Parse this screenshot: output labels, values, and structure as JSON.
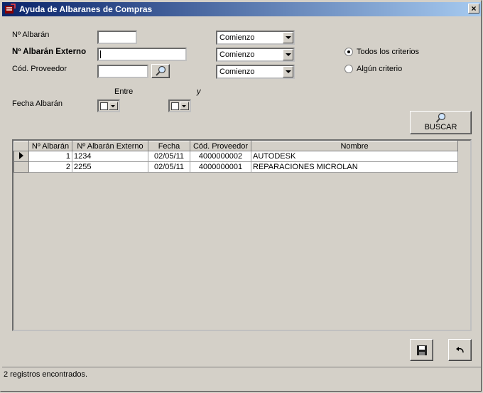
{
  "window": {
    "title": "Ayuda de Albaranes de Compras",
    "close": "×"
  },
  "form": {
    "albaran_label": "Nº Albarán",
    "externo_label": "Nº Albarán Externo",
    "proveedor_label": "Cód. Proveedor",
    "entre_label": "Entre",
    "y_label": "y",
    "fecha_label": "Fecha Albarán",
    "combo_albaran": "Comienzo",
    "combo_externo": "Comienzo",
    "combo_proveedor": "Comienzo",
    "radio_todos": "Todos los criterios",
    "radio_alguno": "Algún criterio",
    "buscar": "BUSCAR"
  },
  "table": {
    "headers": [
      "Nº Albarán",
      "Nº Albarán Externo",
      "Fecha",
      "Cód. Proveedor",
      "Nombre"
    ],
    "rows": [
      {
        "albaran": "1",
        "externo": "1234",
        "fecha": "02/05/11",
        "proveedor": "4000000002",
        "nombre": "AUTODESK"
      },
      {
        "albaran": "2",
        "externo": "2255",
        "fecha": "02/05/11",
        "proveedor": "4000000001",
        "nombre": "REPARACIONES MICROLAN"
      }
    ]
  },
  "status": {
    "text": "2 registros encontrados."
  },
  "icons": {
    "app": "app-icon",
    "search": "magnifier-icon",
    "save": "floppy-disk-icon",
    "undo": "undo-arrow-icon"
  }
}
